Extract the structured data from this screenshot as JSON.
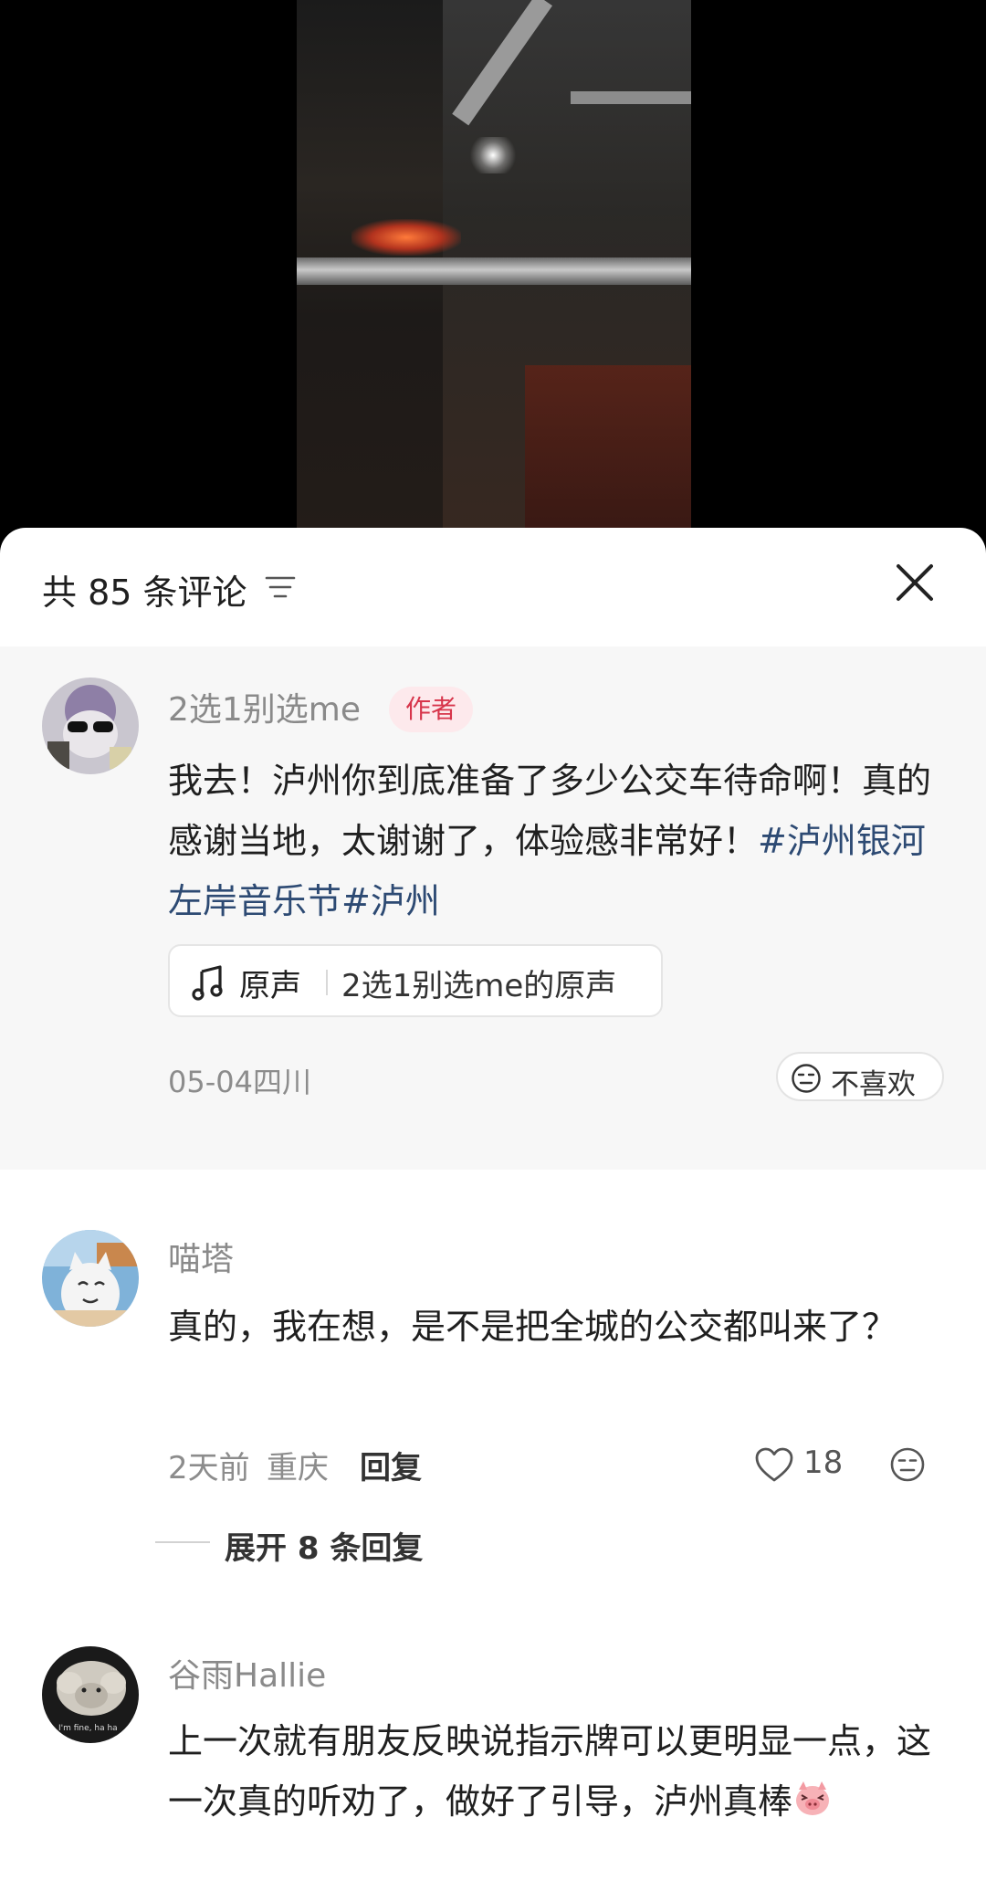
{
  "header": {
    "comment_count_label": "共 85 条评论"
  },
  "pinned_comment": {
    "username": "2选1别选me",
    "badge": "作者",
    "text_plain": "我去！泸州你到底准备了多少公交车待命啊！真的感谢当地，太谢谢了，体验感非常好！",
    "hashtag_1": "#泸州银河左岸音乐节",
    "hashtag_2": "#泸州",
    "sound_label": "原声",
    "sound_source": "2选1别选me的原声",
    "meta": "05-04四川",
    "dislike_label": "不喜欢"
  },
  "comments": [
    {
      "username": "喵塔",
      "text": "真的，我在想，是不是把全城的公交都叫来了？",
      "time": "2天前",
      "location": "重庆",
      "reply_label": "回复",
      "likes": "18",
      "expand_label": "展开 8 条回复"
    },
    {
      "username": "谷雨Hallie",
      "text": "上一次就有朋友反映说指示牌可以更明显一点，这一次真的听劝了，做好了引导，泸州真棒"
    }
  ],
  "icons": {
    "filter": "filter-icon",
    "close": "close-icon",
    "music_note": "music-note-icon",
    "dislike_face": "neutral-face-icon",
    "heart": "heart-icon",
    "pig_emoji": "pig-emoji-icon"
  },
  "colors": {
    "author_badge_bg": "#fde9ec",
    "author_badge_text": "#d7354b",
    "hashtag": "#2d4a73",
    "pinned_bg": "#f7f7f7"
  }
}
